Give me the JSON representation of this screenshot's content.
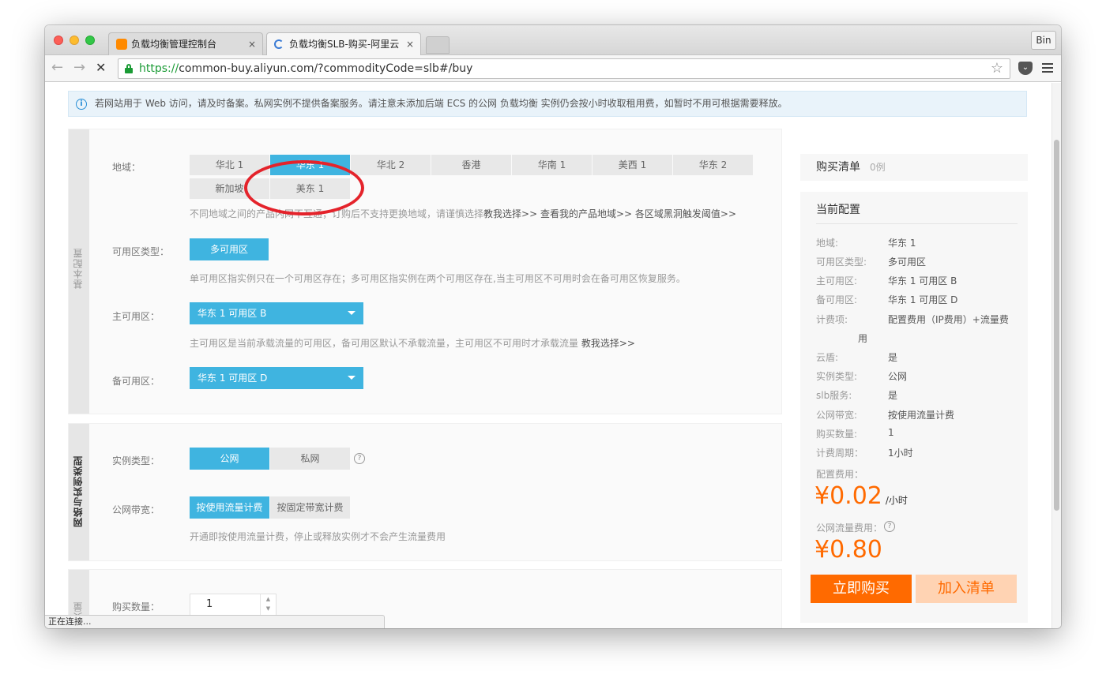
{
  "browser": {
    "tabs": [
      {
        "title": "负载均衡管理控制台",
        "close": "×"
      },
      {
        "title": "负载均衡SLB-购买-阿里云",
        "close": "×"
      }
    ],
    "user_label": "Bin",
    "url_scheme": "https://",
    "url_rest": "common-buy.aliyun.com/?commodityCode=slb#/buy",
    "status_text": "正在连接..."
  },
  "notice": {
    "text": "若网站用于 Web 访问，请及时备案。私网实例不提供备案服务。请注意未添加后端 ECS 的公网 负载均衡 实例仍会按小时收取租用费，如暂时不用可根据需要释放。"
  },
  "section_basic": {
    "bar_label": "基本配置",
    "region_label": "地域：",
    "regions": [
      "华北 1",
      "华东 1",
      "华北 2",
      "香港",
      "华南 1",
      "美西 1",
      "华东 2",
      "新加坡",
      "美东 1"
    ],
    "selected_region": "华东 1",
    "region_hint": "不同地域之间的产品内网不互通；订购后不支持更换地域，请谨慎选择",
    "region_links": [
      "教我选择>>",
      "查看我的产品地域>>",
      "各区域黑洞触发阈值>>"
    ],
    "zone_type_label": "可用区类型：",
    "zone_type_value": "多可用区",
    "zone_type_hint": "单可用区指实例只在一个可用区存在；多可用区指实例在两个可用区存在,当主可用区不可用时会在备可用区恢复服务。",
    "primary_zone_label": "主可用区：",
    "primary_zone_value": "华东 1 可用区 B",
    "primary_zone_hint": "主可用区是当前承载流量的可用区，备可用区默认不承载流量，主可用区不可用时才承载流量",
    "primary_zone_link": "教我选择>>",
    "backup_zone_label": "备可用区：",
    "backup_zone_value": "华东 1 可用区 D"
  },
  "section_network": {
    "bar_label": "网络与实例类型",
    "instance_type_label": "实例类型：",
    "instance_types": [
      "公网",
      "私网"
    ],
    "bandwidth_label": "公网带宽：",
    "bandwidth_options": [
      "按使用流量计费",
      "按固定带宽计费"
    ],
    "bandwidth_hint": "开通即按使用流量计费，停止或释放实例才不会产生流量费用"
  },
  "section_qty": {
    "bar_label": "购买量",
    "qty_label": "购买数量：",
    "qty_value": "1"
  },
  "cart": {
    "title": "购买清单",
    "count": "0例"
  },
  "config": {
    "title": "当前配置",
    "rows": [
      {
        "label": "地域:",
        "value": "华东 1"
      },
      {
        "label": "可用区类型:",
        "value": "多可用区"
      },
      {
        "label": "主可用区:",
        "value": "华东 1 可用区 B"
      },
      {
        "label": "备可用区:",
        "value": "华东 1 可用区 D"
      },
      {
        "label": "计费项:",
        "value": "配置费用（IP费用）+流量费"
      },
      {
        "label": "",
        "value": "用"
      },
      {
        "label": "云盾:",
        "value": "是"
      },
      {
        "label": "实例类型:",
        "value": "公网"
      },
      {
        "label": "slb服务:",
        "value": "是"
      },
      {
        "label": "公网带宽:",
        "value": "按使用流量计费"
      },
      {
        "label": "购买数量:",
        "value": "1"
      },
      {
        "label": "计费周期：",
        "value": "1小时"
      }
    ],
    "config_fee_label": "配置费用：",
    "config_fee": "¥0.02",
    "config_fee_unit": "/小时",
    "traffic_fee_label": "公网流量费用：",
    "traffic_fee": "¥0.80",
    "buy_label": "立即购买",
    "add_label": "加入清单"
  },
  "colors": {
    "accent": "#3fb4e0",
    "orange": "#ff6a00",
    "annotation": "#e4232b"
  }
}
